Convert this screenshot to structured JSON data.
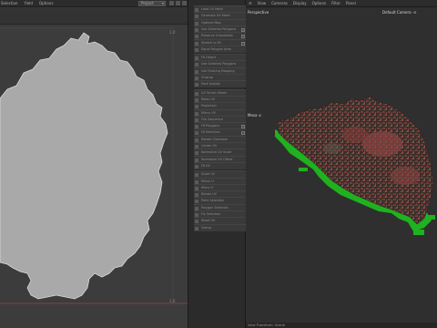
{
  "uv_menu": [
    "Selection",
    "Yield",
    "Options"
  ],
  "uv_view_dropdown": "Project",
  "uv_ticks": {
    "top_right": "1.0",
    "bottom_right": "1.0"
  },
  "tools": [
    {
      "label": "Load UV Mesh",
      "check": false
    },
    {
      "label": "Generate UV Mesh",
      "check": false
    },
    {
      "label": "Optimal Map",
      "check": false
    },
    {
      "label": "Use Selected Polygons",
      "check": true
    },
    {
      "label": "Preserve Orientation",
      "check": true
    },
    {
      "label": "Stretch to Fit",
      "check": true
    },
    {
      "label": "Equal Polygon Area",
      "check": false
    },
    {
      "label": "Fit Object",
      "check": false
    },
    {
      "label": "Use Selected Polygons",
      "check": false
    },
    {
      "label": "Use Existing Mapping",
      "check": false
    },
    {
      "label": "Unwrap",
      "check": false
    },
    {
      "label": "Pack Islands",
      "check": false
    },
    {
      "label": "UV Terrain Mode",
      "check": false
    },
    {
      "label": "Relax UV",
      "check": false
    },
    {
      "label": "Projection",
      "check": false
    },
    {
      "label": "Mirror UV",
      "check": false
    },
    {
      "label": "Flip Sequence",
      "check": false
    },
    {
      "label": "Fit Polygons",
      "check": true
    },
    {
      "label": "Fit Selection",
      "check": true
    },
    {
      "label": "Rotate Clockwise",
      "check": false
    },
    {
      "label": "Center UV",
      "check": false
    },
    {
      "label": "Normalize UV Scale",
      "check": false
    },
    {
      "label": "Normalize UV Offset",
      "check": false
    },
    {
      "label": "Fit UV",
      "check": false
    },
    {
      "label": "Scale UV",
      "check": false
    },
    {
      "label": "Mirror U",
      "check": false
    },
    {
      "label": "Mirror V",
      "check": false
    },
    {
      "label": "Rotate UV",
      "check": false
    },
    {
      "label": "Point Selection",
      "check": false
    },
    {
      "label": "Polygon Selection",
      "check": false
    },
    {
      "label": "Fix Selection",
      "check": false
    },
    {
      "label": "Reset UV",
      "check": false
    },
    {
      "label": "Clamp",
      "check": false
    }
  ],
  "viewport": {
    "menu": [
      "View",
      "Cameras",
      "Display",
      "Options",
      "Filter",
      "Panel"
    ],
    "view_label": "Perspective",
    "camera_label": "Default Camera ·⊙",
    "object_label": "Mesa ⊙",
    "status": "View Transform: Scene"
  },
  "colors": {
    "accent_green": "#1fb11f",
    "terrain_red": "#7a3a36",
    "uv_island": "#a9a9a9"
  }
}
